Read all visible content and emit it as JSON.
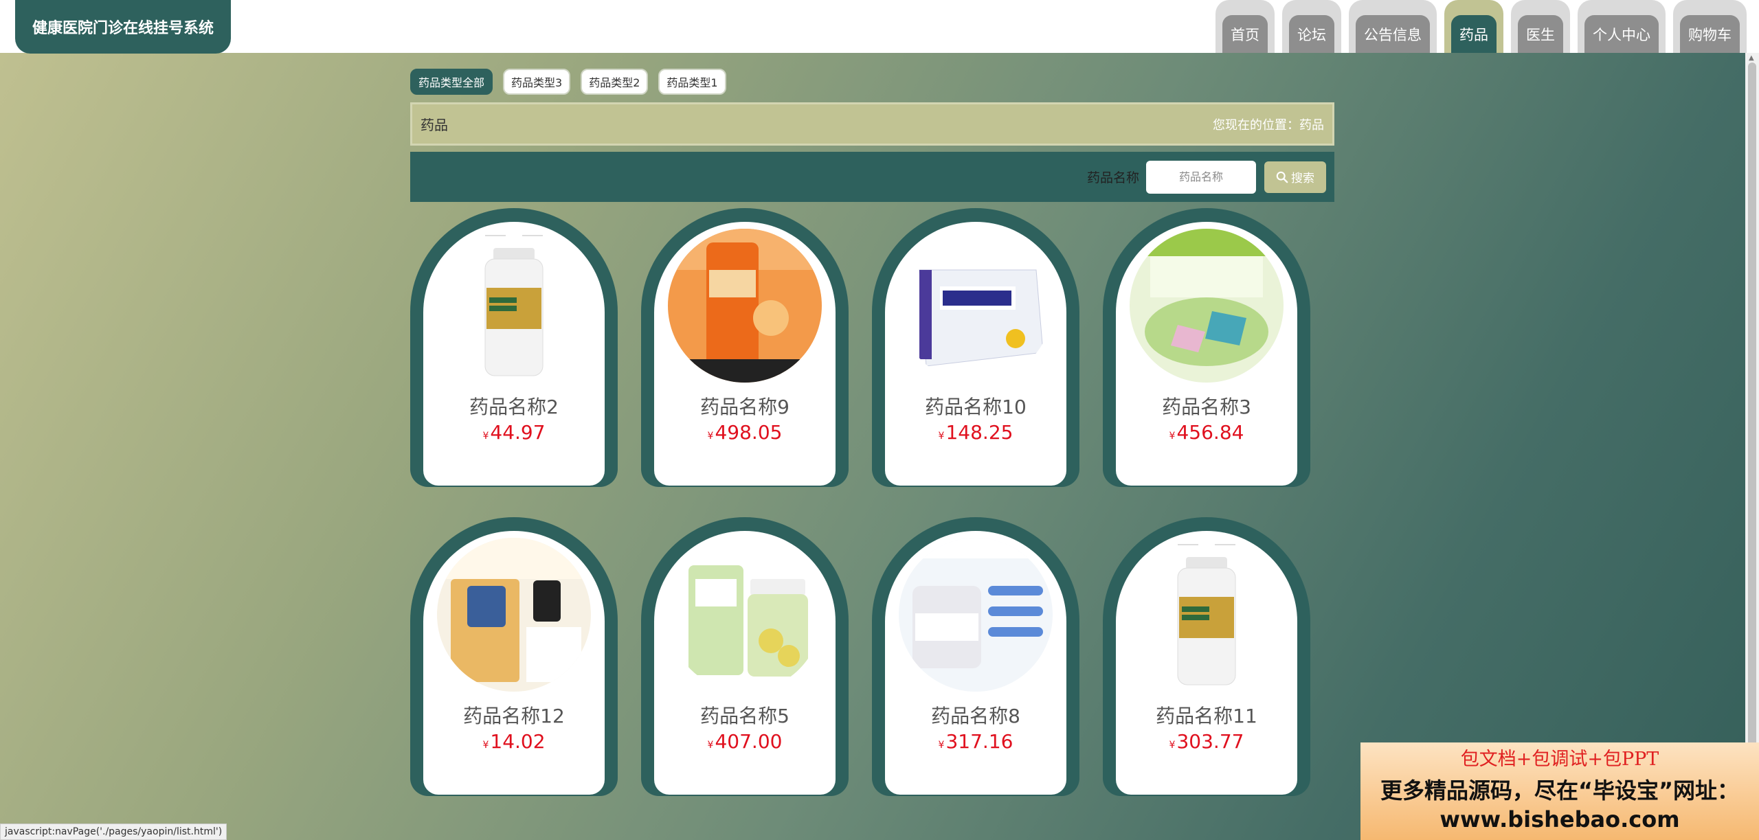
{
  "header": {
    "brand": "健康医院门诊在线挂号系统",
    "nav": [
      "首页",
      "论坛",
      "公告信息",
      "药品",
      "医生",
      "个人中心",
      "购物车"
    ],
    "active_nav": "药品"
  },
  "categories": [
    "药品类型全部",
    "药品类型3",
    "药品类型2",
    "药品类型1"
  ],
  "breadcrumb": {
    "title": "药品",
    "location": "您现在的位置：药品"
  },
  "search": {
    "label": "药品名称",
    "placeholder": "药品名称",
    "button": "搜索"
  },
  "currency_symbol": "¥",
  "products": [
    {
      "name": "药品名称2",
      "price": "44.97",
      "thumb": "white-bottle"
    },
    {
      "name": "药品名称9",
      "price": "498.05",
      "thumb": "orange-bottle"
    },
    {
      "name": "药品名称10",
      "price": "148.25",
      "thumb": "medicine-box"
    },
    {
      "name": "药品名称3",
      "price": "456.84",
      "thumb": "vitamin-tablets"
    },
    {
      "name": "药品名称12",
      "price": "14.02",
      "thumb": "supplement-chart"
    },
    {
      "name": "药品名称5",
      "price": "407.00",
      "thumb": "capsule-bottle"
    },
    {
      "name": "药品名称8",
      "price": "317.16",
      "thumb": "calcium-bottle"
    },
    {
      "name": "药品名称11",
      "price": "303.77",
      "thumb": "white-bottle"
    }
  ],
  "status_bar": "javascript:navPage('./pages/yaopin/list.html')",
  "promo": {
    "line1": "包文档+包调试+包PPT",
    "line2": "更多精品源码，尽在“毕设宝”网址：",
    "line3": "www.bishebao.com"
  },
  "colors": {
    "primary": "#2e615d",
    "accent": "#c1c393",
    "price": "#e0101e"
  }
}
